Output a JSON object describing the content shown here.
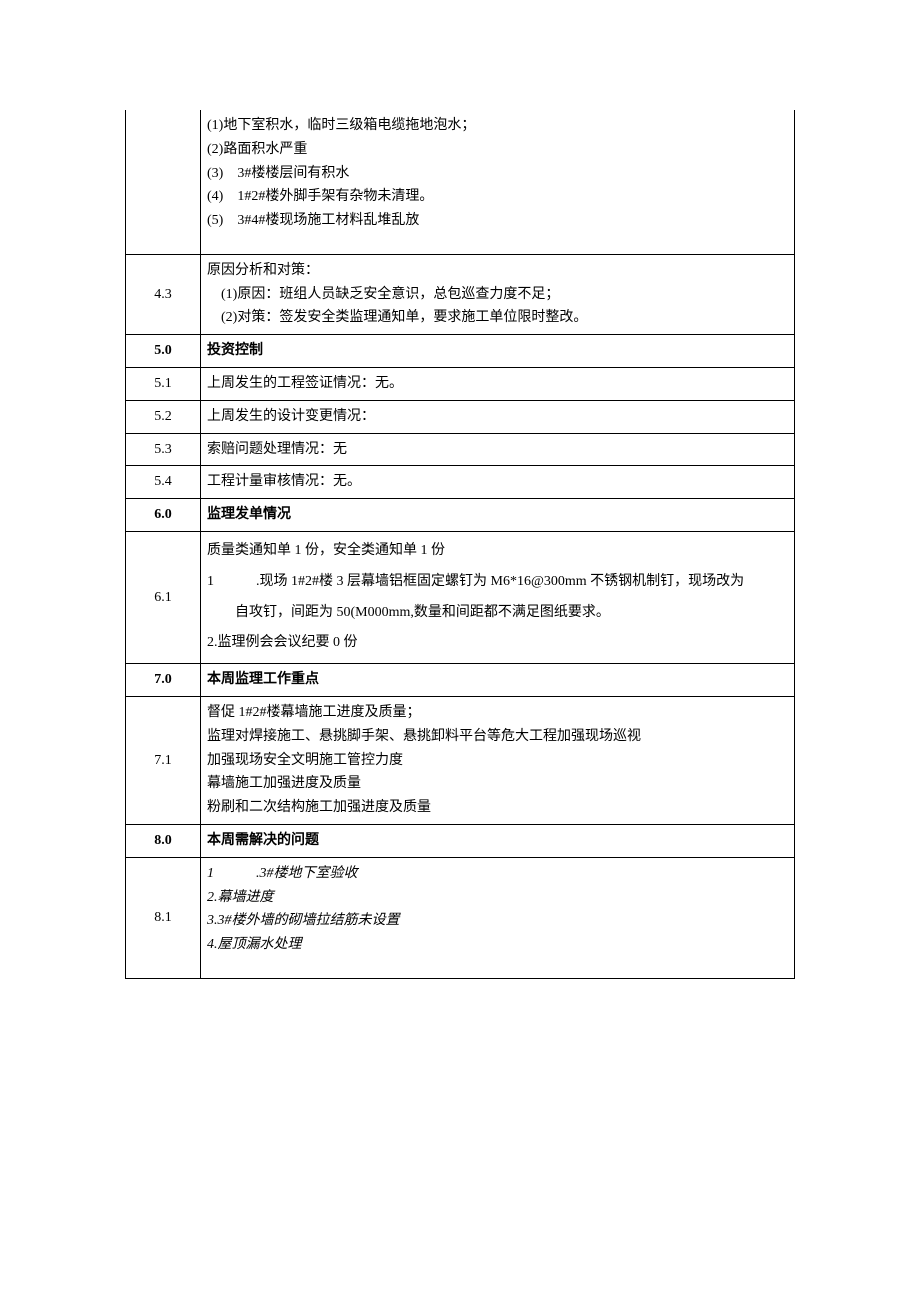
{
  "rows": {
    "r1": {
      "num": "",
      "lines": [
        "(1)地下室积水，临时三级箱电缆拖地泡水；",
        "(2)路面积水严重",
        "(3)　3#楼楼层间有积水",
        "(4)　1#2#楼外脚手架有杂物未清理。",
        "(5)　3#4#楼现场施工材料乱堆乱放"
      ]
    },
    "r2": {
      "num": "4.3",
      "lines": [
        "原因分析和对策：",
        "　(1)原因：班组人员缺乏安全意识，总包巡查力度不足；",
        "　(2)对策：签发安全类监理通知单，要求施工单位限时整改。"
      ]
    },
    "r3": {
      "num": "5.0",
      "text": "投资控制"
    },
    "r4": {
      "num": "5.1",
      "text": "上周发生的工程签证情况：无。"
    },
    "r5": {
      "num": "5.2",
      "text": "上周发生的设计变更情况："
    },
    "r6": {
      "num": "5.3",
      "text": "索赔问题处理情况：无"
    },
    "r7": {
      "num": "5.4",
      "text": "工程计量审核情况：无。"
    },
    "r8": {
      "num": "6.0",
      "text": "监理发单情况"
    },
    "r9": {
      "num": "6.1",
      "lines": [
        "质量类通知单 1 份，安全类通知单 1 份",
        "1　　　.现场 1#2#楼 3 层幕墙铝框固定螺钉为 M6*16@300mm 不锈钢机制钉，现场改为",
        "　　自攻钉，间距为 50(M000mm,数量和间距都不满足图纸要求。",
        "2.监理例会会议纪要 0 份"
      ]
    },
    "r10": {
      "num": "7.0",
      "text": "本周监理工作重点"
    },
    "r11": {
      "num": "7.1",
      "lines": [
        "督促 1#2#楼幕墙施工进度及质量；",
        "监理对焊接施工、悬挑脚手架、悬挑卸料平台等危大工程加强现场巡视",
        "加强现场安全文明施工管控力度",
        "幕墙施工加强进度及质量",
        "粉刷和二次结构施工加强进度及质量"
      ]
    },
    "r12": {
      "num": "8.0",
      "text": "本周需解决的问题"
    },
    "r13": {
      "num": "8.1",
      "lines": [
        "1　　　.3#楼地下室验收",
        "2.幕墙进度",
        "3.3#楼外墙的砌墙拉结筋未设置",
        "4.屋顶漏水处理"
      ]
    }
  }
}
